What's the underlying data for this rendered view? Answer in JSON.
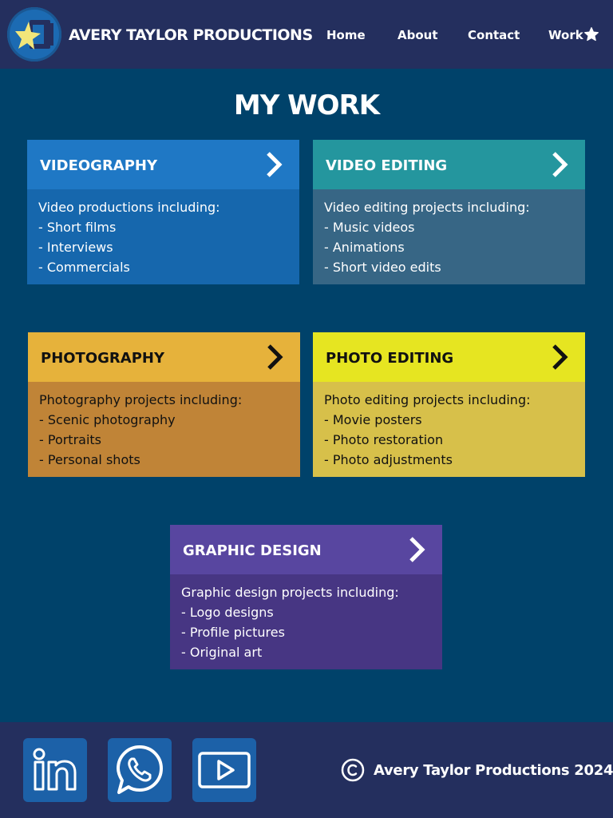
{
  "header": {
    "brand": "AVERY TAYLOR PRODUCTIONS",
    "nav": [
      {
        "label": "Home"
      },
      {
        "label": "About"
      },
      {
        "label": "Contact"
      },
      {
        "label": "Work"
      }
    ]
  },
  "main": {
    "title": "MY WORK",
    "cards": [
      {
        "title": "VIDEOGRAPHY",
        "intro": "Video productions including:",
        "items": [
          "- Short films",
          "- Interviews",
          "- Commercials"
        ],
        "head_color": "#1f78c5",
        "body_color": "#1667ad",
        "text_color": "#ffffff"
      },
      {
        "title": "VIDEO EDITING",
        "intro": "Video editing projects including:",
        "items": [
          "- Music videos",
          "- Animations",
          "- Short video edits"
        ],
        "head_color": "#24969e",
        "body_color": "#376685",
        "text_color": "#ffffff"
      },
      {
        "title": "PHOTOGRAPHY",
        "intro": "Photography projects including:",
        "items": [
          "- Scenic photography",
          "- Portraits",
          "- Personal shots"
        ],
        "head_color": "#e6b23b",
        "body_color": "#c08437",
        "text_color": "#111111"
      },
      {
        "title": "PHOTO EDITING",
        "intro": "Photo editing projects including:",
        "items": [
          "- Movie posters",
          "- Photo restoration",
          "- Photo adjustments"
        ],
        "head_color": "#e6e521",
        "body_color": "#d7c04a",
        "text_color": "#111111"
      },
      {
        "title": "GRAPHIC DESIGN",
        "intro": "Graphic design projects including:",
        "items": [
          "- Logo designs",
          "- Profile pictures",
          "- Original art"
        ],
        "head_color": "#5846a0",
        "body_color": "#473683",
        "text_color": "#ffffff"
      }
    ]
  },
  "footer": {
    "social": [
      {
        "icon": "linkedin-icon"
      },
      {
        "icon": "whatsapp-icon"
      },
      {
        "icon": "youtube-icon"
      }
    ],
    "copyright": "Avery Taylor Productions 2024"
  }
}
